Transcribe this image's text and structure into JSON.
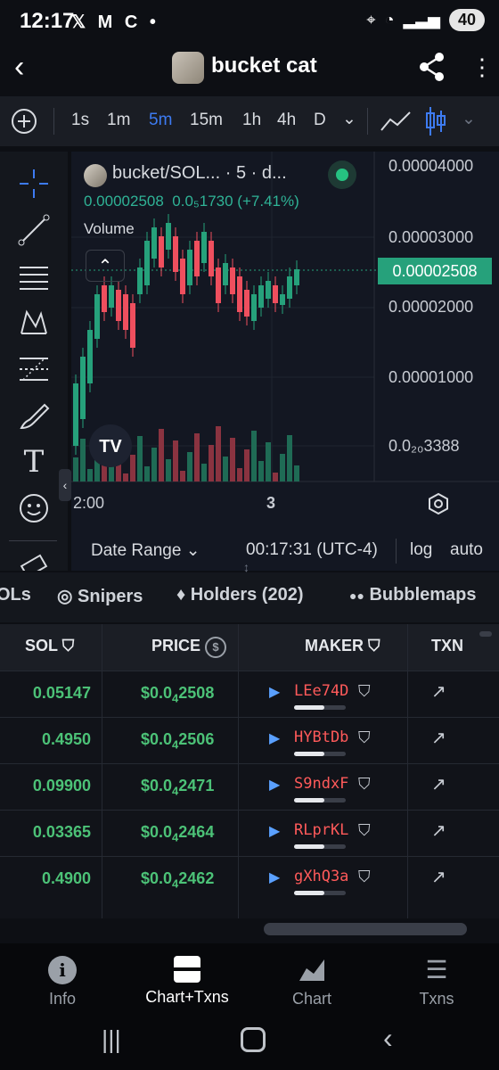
{
  "status_bar": {
    "time": "12:17",
    "notifications": "𝕏 M C •",
    "battery": "40"
  },
  "header": {
    "title": "bucket cat"
  },
  "toolbar": {
    "intervals": [
      "1s",
      "1m",
      "5m",
      "15m",
      "1h",
      "4h",
      "D"
    ],
    "active_interval": "5m"
  },
  "chart": {
    "legend_symbol": "bucket/SOL... · 5 · d...",
    "last_price": "0.00002508",
    "change": "0.0₅1730 (+7.41%)",
    "volume_label": "Volume",
    "price_ticks": [
      "0.00004000",
      "0.00003000",
      "0.00002000",
      "0.00001000",
      "0.0₂₀3388"
    ],
    "current_price_tag": "0.00002508",
    "time_ticks": [
      "2:00",
      "3"
    ],
    "date_range": "Date Range",
    "clock": "00:17:31 (UTC-4)",
    "log": "log",
    "auto": "auto"
  },
  "tabs": {
    "t0": "OLs",
    "t1": "Snipers",
    "t2": "Holders (202)",
    "t3": "Bubblemaps"
  },
  "table": {
    "headers": {
      "sol": "SOL",
      "price": "PRICE",
      "maker": "MAKER",
      "txn": "TXN"
    },
    "rows": [
      {
        "sol": "0.05147",
        "price_a": "$0.0",
        "price_sub": "4",
        "price_b": "2508",
        "maker": "LEe74D"
      },
      {
        "sol": "0.4950",
        "price_a": "$0.0",
        "price_sub": "4",
        "price_b": "2506",
        "maker": "HYBtDb"
      },
      {
        "sol": "0.09900",
        "price_a": "$0.0",
        "price_sub": "4",
        "price_b": "2471",
        "maker": "S9ndxF"
      },
      {
        "sol": "0.03365",
        "price_a": "$0.0",
        "price_sub": "4",
        "price_b": "2464",
        "maker": "RLprKL"
      },
      {
        "sol": "0.4900",
        "price_a": "$0.0",
        "price_sub": "4",
        "price_b": "2462",
        "maker": "gXhQ3a"
      }
    ]
  },
  "bottom_nav": {
    "info": "Info",
    "chart_txns": "Chart+Txns",
    "chart": "Chart",
    "txns": "Txns"
  },
  "colors": {
    "accent": "#3d7bf2",
    "up": "#26a17b",
    "down": "#ef4f5e",
    "buy_text": "#4cc277"
  }
}
